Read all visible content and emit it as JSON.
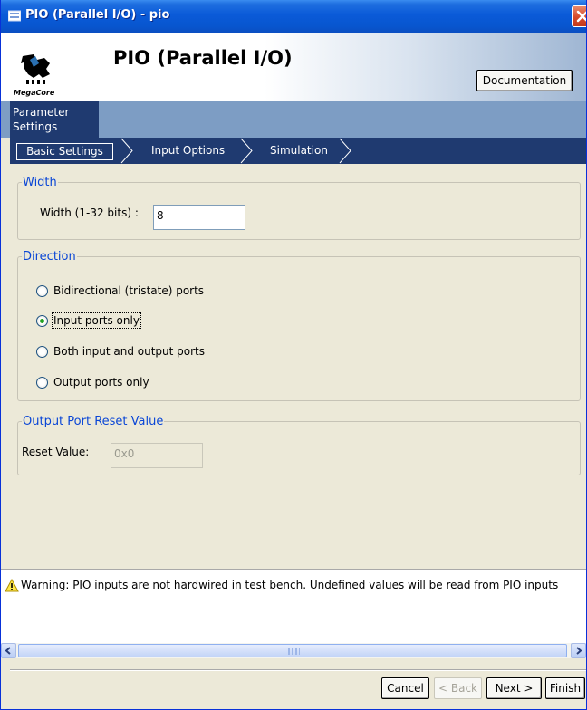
{
  "window": {
    "title": "PIO (Parallel I/O) - pio"
  },
  "header": {
    "title": "PIO (Parallel I/O)",
    "logo_text": "MegaCore",
    "documentation_label": "Documentation"
  },
  "tabs": {
    "parameter_settings_line1": "Parameter",
    "parameter_settings_line2": "Settings"
  },
  "nav": {
    "items": [
      {
        "label": "Basic Settings",
        "active": true
      },
      {
        "label": "Input Options",
        "active": false
      },
      {
        "label": "Simulation",
        "active": false
      }
    ]
  },
  "width_group": {
    "legend": "Width",
    "label": "Width (1-32 bits) :",
    "value": "8"
  },
  "direction_group": {
    "legend": "Direction",
    "options": [
      {
        "label": "Bidirectional (tristate) ports",
        "selected": false
      },
      {
        "label": "Input ports only",
        "selected": true
      },
      {
        "label": "Both input and output ports",
        "selected": false
      },
      {
        "label": "Output ports only",
        "selected": false
      }
    ]
  },
  "reset_group": {
    "legend": "Output Port Reset Value",
    "label": "Reset Value:",
    "value": "0x0"
  },
  "messages": {
    "warning": "Warning: PIO inputs are not hardwired in test bench. Undefined values will be read from PIO inputs"
  },
  "buttons": {
    "cancel": "Cancel",
    "back": "< Back",
    "next": "Next >",
    "finish": "Finish"
  },
  "colors": {
    "titlebar": "#0a5ad8",
    "nav_bg": "#1f3a70",
    "legend": "#0a46d6",
    "radio_selected": "#21a121"
  }
}
